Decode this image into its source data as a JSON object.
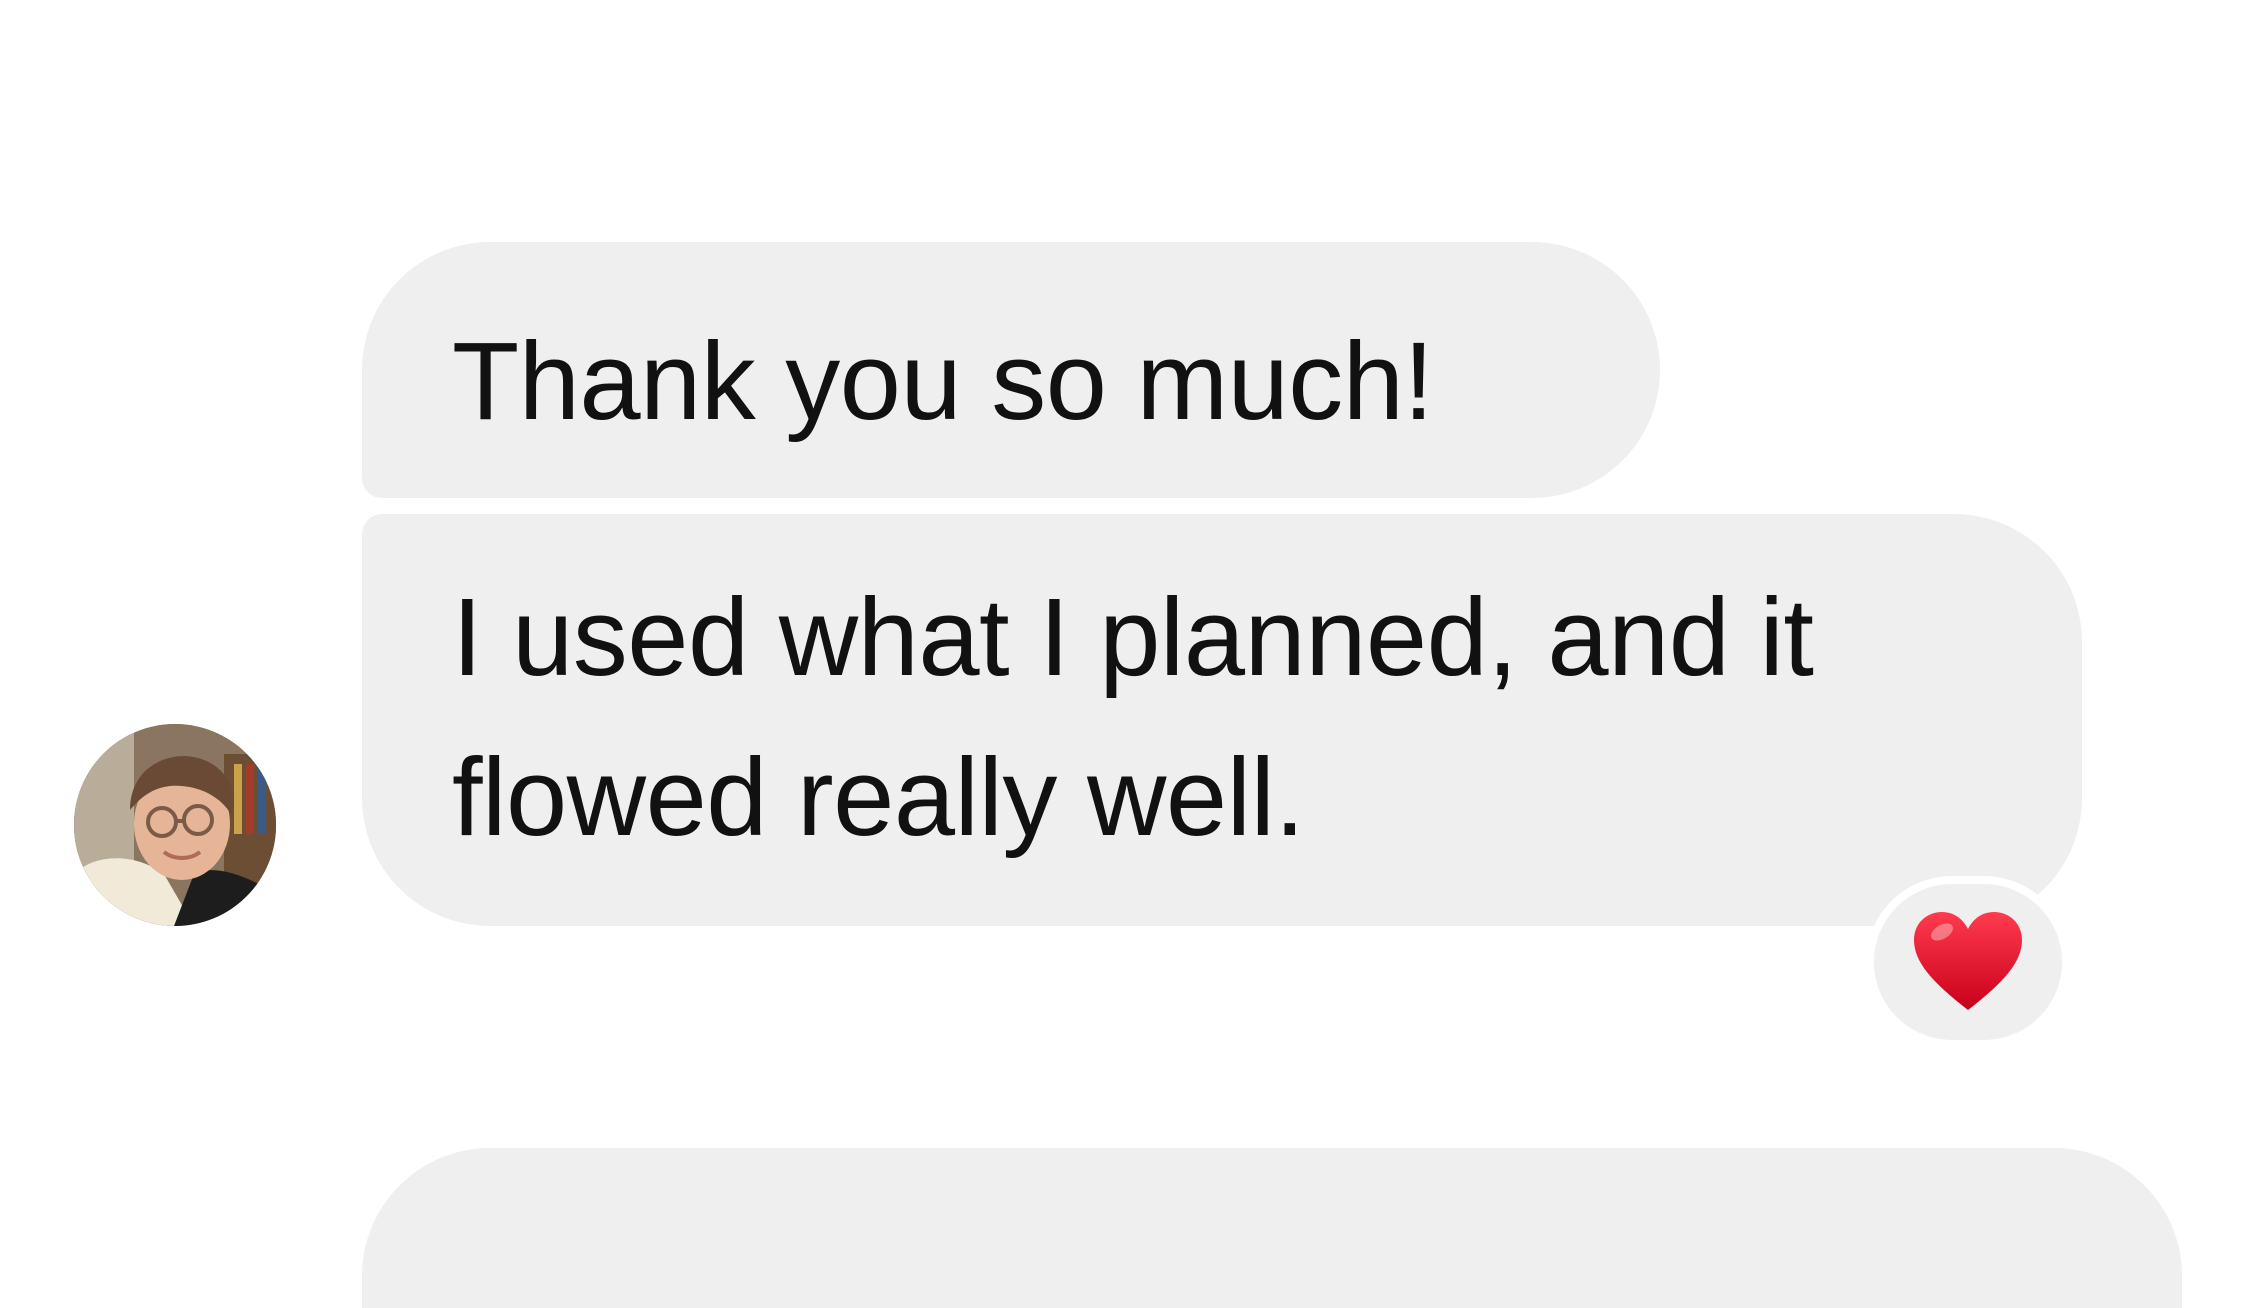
{
  "conversation": {
    "messages": [
      {
        "text": "Thank you so much!"
      },
      {
        "lines": [
          "I used what I planned, and it",
          "flowed really well."
        ],
        "reaction": "red-heart-icon"
      }
    ]
  },
  "avatar": {
    "icon": "contact-avatar-photo"
  },
  "colors": {
    "incoming_bubble": "#efefef",
    "text": "#111111",
    "heart": "#e0112b",
    "background": "#ffffff"
  }
}
